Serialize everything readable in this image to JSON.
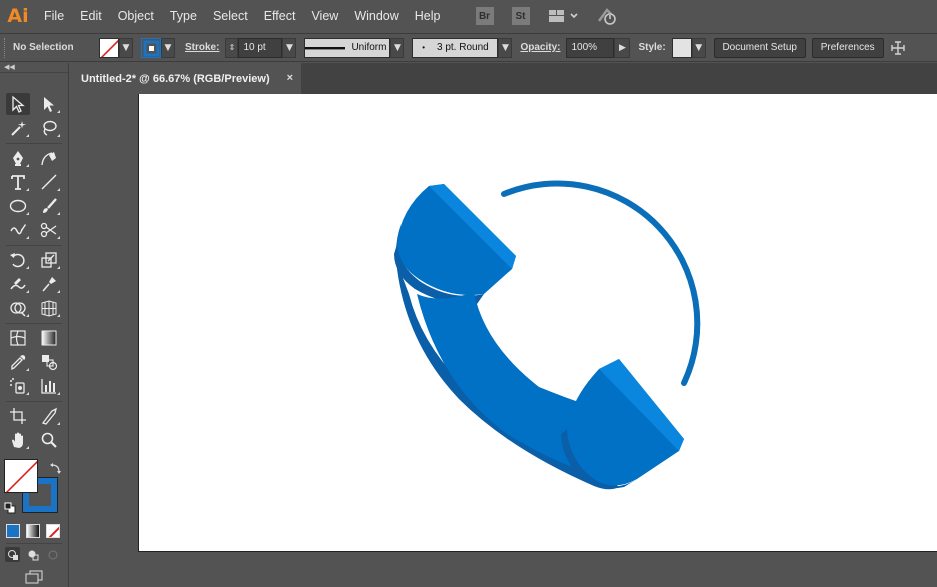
{
  "app": {
    "logo_text": "Ai",
    "brand_color": "#f08a24"
  },
  "menu": {
    "items": [
      "File",
      "Edit",
      "Object",
      "Type",
      "Select",
      "Effect",
      "View",
      "Window",
      "Help"
    ],
    "bridge": "Br",
    "stock": "St",
    "icons": [
      "bridge-icon",
      "stock-icon",
      "workspace-arrange-icon",
      "gpu-performance-icon"
    ]
  },
  "controlbar": {
    "selection_label": "No Selection",
    "stroke_label": "Stroke:",
    "stroke_weight": "10 pt",
    "profile": "Uniform",
    "brush": "3 pt. Round",
    "opacity_label": "Opacity:",
    "opacity_value": "100%",
    "style_label": "Style:",
    "document_setup": "Document Setup",
    "preferences": "Preferences",
    "fill_color": "none",
    "stroke_color": "#1a73c5"
  },
  "document": {
    "tab_title": "Untitled-2* @ 66.67% (RGB/Preview)",
    "close_glyph": "×"
  },
  "toolbox": {
    "fill": "none",
    "stroke_color": "#1a73c5",
    "tools": [
      "selection-tool",
      "direct-selection-tool",
      "magic-wand-tool",
      "lasso-tool",
      "pen-tool",
      "curvature-tool",
      "type-tool",
      "line-segment-tool",
      "ellipse-tool",
      "paintbrush-tool",
      "shaper-tool",
      "scissors-tool",
      "rotate-tool",
      "scale-tool",
      "warp-tool",
      "puppet-warp-tool",
      "shape-builder-tool",
      "perspective-grid-tool",
      "mesh-tool",
      "gradient-tool",
      "eyedropper-tool",
      "blend-tool",
      "symbol-sprayer-tool",
      "column-graph-tool",
      "artboard-tool",
      "slice-tool",
      "hand-tool",
      "zoom-tool"
    ]
  },
  "artwork": {
    "colors": {
      "primary": "#0071c5",
      "light": "#0a86de",
      "dark": "#0a5fa8",
      "arc": "#0a6fb8"
    }
  }
}
